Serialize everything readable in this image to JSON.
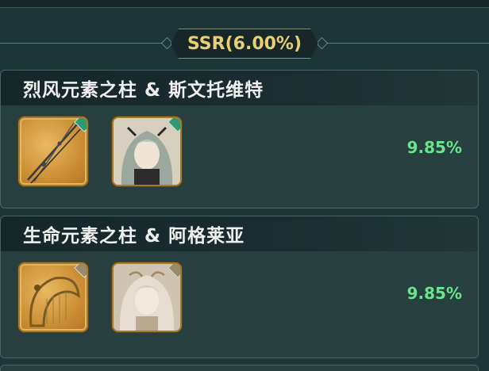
{
  "tier": {
    "label": "SSR(6.00%)"
  },
  "pools": [
    {
      "title": "烈风元素之柱 & 斯文托维特",
      "rate": "9.85%",
      "items": [
        {
          "icon": "spear-weapon-icon",
          "element": "wind-element-icon"
        },
        {
          "icon": "character-portrait-icon",
          "element": "wind-element-icon"
        }
      ]
    },
    {
      "title": "生命元素之柱 & 阿格莱亚",
      "rate": "9.85%",
      "items": [
        {
          "icon": "harp-weapon-icon",
          "element": "life-element-icon"
        },
        {
          "icon": "character-portrait-icon",
          "element": "life-element-icon"
        }
      ]
    }
  ],
  "colors": {
    "background": "#1e3538",
    "tier_text": "#e8cf72",
    "rate_text": "#69e68b",
    "wind_element": "#2f9a72",
    "life_element": "#9a8a6a"
  }
}
